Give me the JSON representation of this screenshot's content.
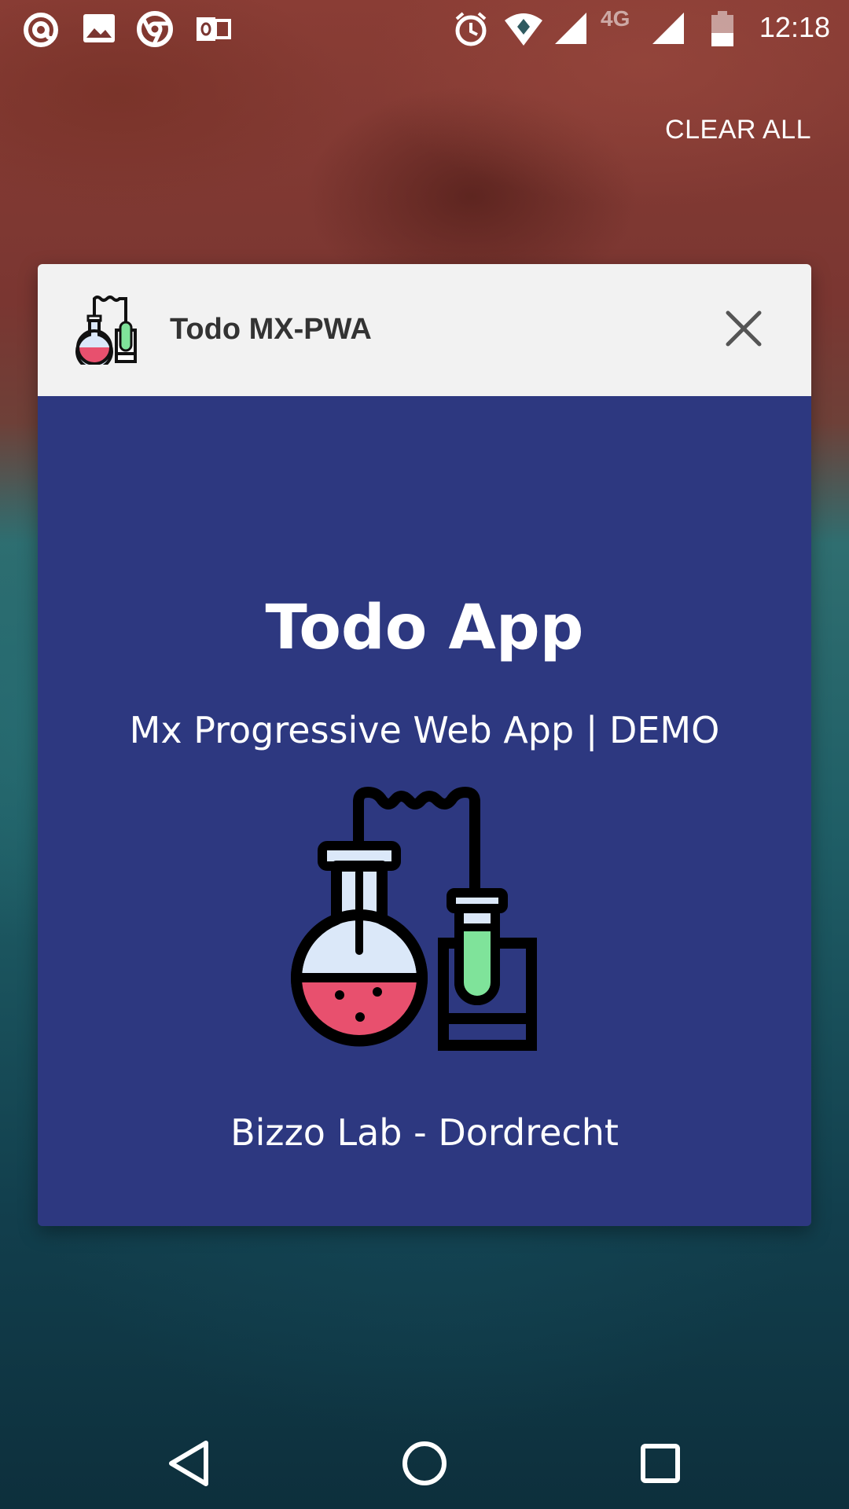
{
  "status_bar": {
    "time": "12:18",
    "network_type": "4G",
    "icons": [
      "at-sign-icon",
      "image-icon",
      "chrome-icon",
      "outlook-icon",
      "alarm-icon",
      "wifi-icon",
      "cell-signal-icon",
      "cell-signal-icon",
      "battery-icon"
    ]
  },
  "recents": {
    "clear_all_label": "CLEAR ALL"
  },
  "task_card": {
    "app_name": "Todo MX-PWA",
    "close_icon": "close-icon",
    "splash": {
      "title": "Todo App",
      "subtitle": "Mx Progressive Web App | DEMO",
      "footer": "Bizzo Lab - Dordrecht",
      "background_color": "#2d3880",
      "illustration": "chemistry-lab-icon"
    }
  },
  "nav_bar": {
    "buttons": [
      "back-icon",
      "home-icon",
      "recents-icon"
    ]
  }
}
